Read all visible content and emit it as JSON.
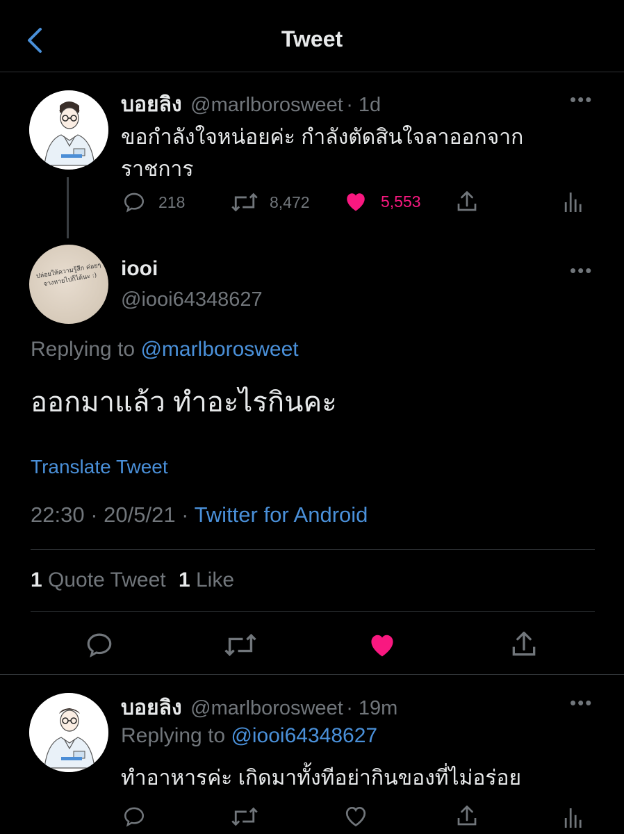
{
  "header": {
    "title": "Tweet"
  },
  "parent_tweet": {
    "name": "บอยลิง",
    "handle": "@marlborosweet",
    "time": "· 1d",
    "text_line1": "ขอกำลังใจหน่อยค่ะ กำลังตัดสินใจลาออกจาก",
    "text_line2": "ราชการ",
    "replies": "218",
    "retweets": "8,472",
    "likes": "5,553"
  },
  "main_tweet": {
    "name": "iooi",
    "handle": "@iooi64348627",
    "avatar_text": "ปล่อยให้ความรู้สึก ค่อยๆจางหายไปก็ได้นะ :)",
    "replying_to_label": "Replying to",
    "replying_to_handle": "@marlborosweet",
    "text": "ออกมาแล้ว ทำอะไรกินคะ",
    "translate": "Translate Tweet",
    "timestamp": "22:30 · 20/5/21 ·",
    "client": "Twitter for Android",
    "quote_count": "1",
    "quote_label": "Quote Tweet",
    "like_count": "1",
    "like_label": "Like"
  },
  "reply_tweet": {
    "name": "บอยลิง",
    "handle": "@marlborosweet",
    "time": "· 19m",
    "replying_to_label": "Replying to",
    "replying_to_handle": "@iooi64348627",
    "text": "ทำอาหารค่ะ เกิดมาทั้งทีอย่ากินของที่ไม่อร่อย"
  },
  "colors": {
    "like": "#f91880",
    "link": "#4a90d9",
    "muted": "#71767b"
  },
  "icons": [
    "back-chevron-icon",
    "more-icon",
    "reply-icon",
    "retweet-icon",
    "like-icon",
    "share-icon",
    "analytics-icon"
  ]
}
